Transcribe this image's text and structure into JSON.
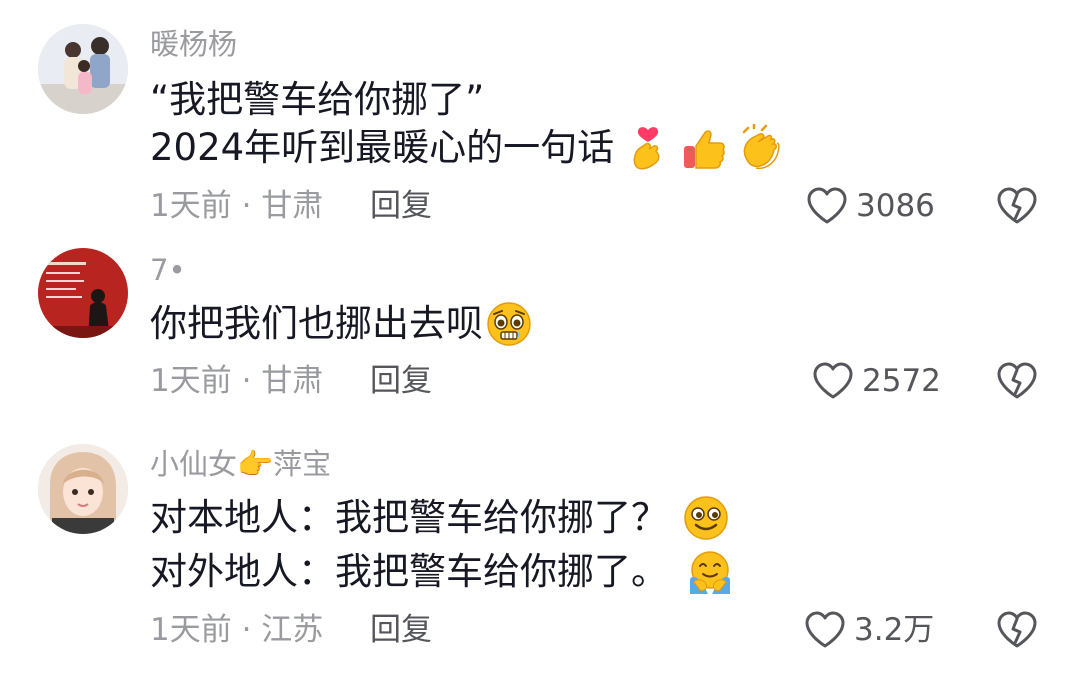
{
  "comments": [
    {
      "username": "暖杨杨",
      "lines": [
        "“我把警车给你挪了”",
        "2024年听到最暖心的一句话"
      ],
      "emojis": [
        "crossed-fingers-heart-emoji",
        "thumbs-up-emoji",
        "clapping-hands-emoji"
      ],
      "time_location": "1天前 · 甘肃",
      "reply_label": "回复",
      "likes": "3086"
    },
    {
      "username": "7•",
      "lines": [
        "你把我们也挪出去呗"
      ],
      "emojis": [
        "pleading-face-emoji"
      ],
      "time_location": "1天前 · 甘肃",
      "reply_label": "回复",
      "likes": "2572"
    },
    {
      "username": "小仙女👉萍宝",
      "lines": [
        "对本地人：我把警车给你挪了？",
        "对外地人：我把警车给你挪了。"
      ],
      "emojis": [
        "smiling-face-emoji",
        "hugging-face-emoji"
      ],
      "time_location": "1天前 · 江苏",
      "reply_label": "回复",
      "likes": "3.2万"
    }
  ],
  "colors": {
    "text_primary": "#161823",
    "text_secondary": "#9a9ba0",
    "text_action": "#55565c"
  }
}
